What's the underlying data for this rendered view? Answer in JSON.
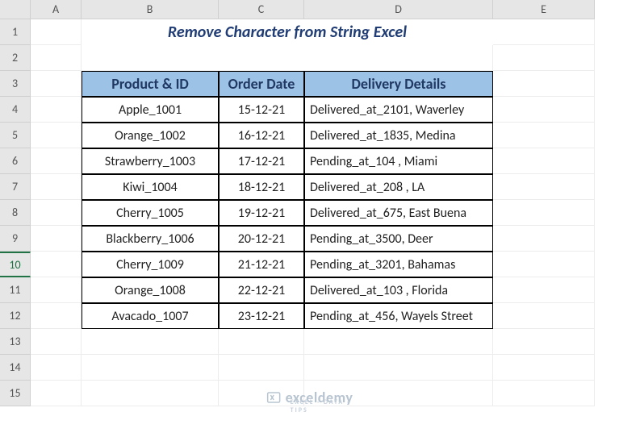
{
  "columns": [
    "A",
    "B",
    "C",
    "D",
    "E"
  ],
  "rows": [
    "1",
    "2",
    "3",
    "4",
    "5",
    "6",
    "7",
    "8",
    "9",
    "10",
    "11",
    "12",
    "13",
    "14",
    "15"
  ],
  "title": "Remove Character from String Excel",
  "table": {
    "headers": [
      "Product & ID",
      "Order Date",
      "Delivery Details"
    ],
    "data": [
      {
        "product": "Apple_1001",
        "date": "15-12-21",
        "delivery": "Delivered_at_2101, Waverley"
      },
      {
        "product": "Orange_1002",
        "date": "16-12-21",
        "delivery": "Delivered_at_1835, Medina"
      },
      {
        "product": "Strawberry_1003",
        "date": "17-12-21",
        "delivery": "Pending_at_104 , Miami"
      },
      {
        "product": "Kiwi_1004",
        "date": "18-12-21",
        "delivery": "Delivered_at_208 , LA"
      },
      {
        "product": "Cherry_1005",
        "date": "19-12-21",
        "delivery": "Delivered_at_675, East Buena"
      },
      {
        "product": "Blackberry_1006",
        "date": "20-12-21",
        "delivery": "Pending_at_3500, Deer"
      },
      {
        "product": "Cherry_1009",
        "date": "21-12-21",
        "delivery": "Pending_at_3201, Bahamas"
      },
      {
        "product": "Orange_1008",
        "date": "22-12-21",
        "delivery": "Delivered_at_103 , Florida"
      },
      {
        "product": "Avacado_1007",
        "date": "23-12-21",
        "delivery": "Pending_at_456, Wayels Street"
      }
    ]
  },
  "watermark": {
    "brand": "exceldemy",
    "tagline": "EXCEL · DATA · TIPS"
  }
}
